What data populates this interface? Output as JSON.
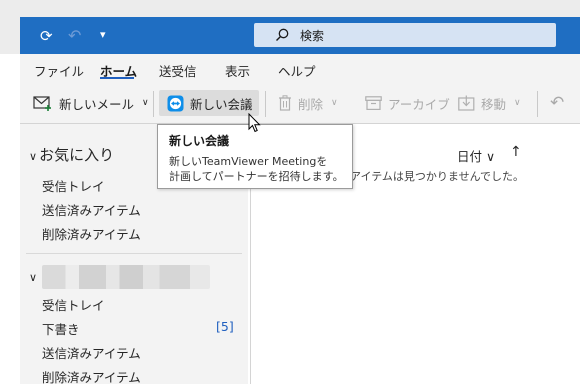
{
  "title_bar": {
    "search_label": "検索"
  },
  "menu": {
    "items": [
      "ファイル",
      "ホーム",
      "送受信",
      "表示",
      "ヘルプ"
    ],
    "active": "ホーム"
  },
  "ribbon": {
    "new_mail": "新しいメール",
    "new_meeting": "新しい会議",
    "delete": "削除",
    "archive": "アーカイブ",
    "move": "移動"
  },
  "tooltip": {
    "title": "新しい会議",
    "line1": "新しいTeamViewer Meetingを",
    "line2": "計画してパートナーを招待します。"
  },
  "folders": {
    "favorites_header": "お気に入り",
    "favorites": [
      "受信トレイ",
      "送信済みアイテム",
      "削除済みアイテム"
    ],
    "account": [
      {
        "name": "受信トレイ",
        "count": ""
      },
      {
        "name": "下書き",
        "count": "[5]"
      },
      {
        "name": "送信済みアイテム",
        "count": ""
      },
      {
        "name": "削除済みアイテム",
        "count": ""
      }
    ]
  },
  "message_list": {
    "sort_label": "日付",
    "empty_text": "アイテムは見つかりませんでした。"
  },
  "colors": {
    "title_bar": "#1f6ec2",
    "accent": "#1f5fbf",
    "teamviewer": "#0e8ee9"
  }
}
